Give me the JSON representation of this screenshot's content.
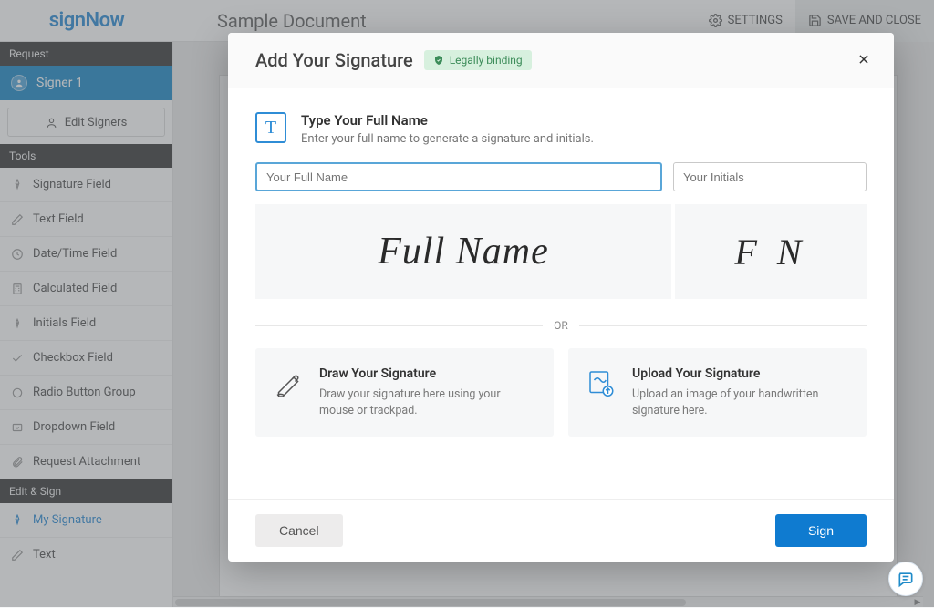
{
  "header": {
    "logo": "signNow",
    "doc_title": "Sample Document",
    "settings_label": "SETTINGS",
    "save_close_label": "SAVE AND CLOSE"
  },
  "sidebar": {
    "request_head": "Request",
    "signer_label": "Signer 1",
    "edit_signers_label": "Edit Signers",
    "tools_head": "Tools",
    "tools": [
      "Signature Field",
      "Text Field",
      "Date/Time Field",
      "Calculated Field",
      "Initials Field",
      "Checkbox Field",
      "Radio Button Group",
      "Dropdown Field",
      "Request Attachment"
    ],
    "edit_sign_head": "Edit & Sign",
    "my_signature_label": "My Signature",
    "text_label": "Text"
  },
  "modal": {
    "title": "Add Your Signature",
    "badge": "Legally binding",
    "type": {
      "title": "Type Your Full Name",
      "desc": "Enter your full name to generate a signature and initials."
    },
    "name_placeholder": "Your Full Name",
    "initials_placeholder": "Your Initials",
    "preview_name": "Full Name",
    "preview_initials": "F N",
    "or": "OR",
    "draw": {
      "title": "Draw Your Signature",
      "desc": "Draw your signature here using your mouse or trackpad."
    },
    "upload": {
      "title": "Upload Your Signature",
      "desc": "Upload an image of your handwritten signature here."
    },
    "cancel": "Cancel",
    "sign": "Sign"
  }
}
